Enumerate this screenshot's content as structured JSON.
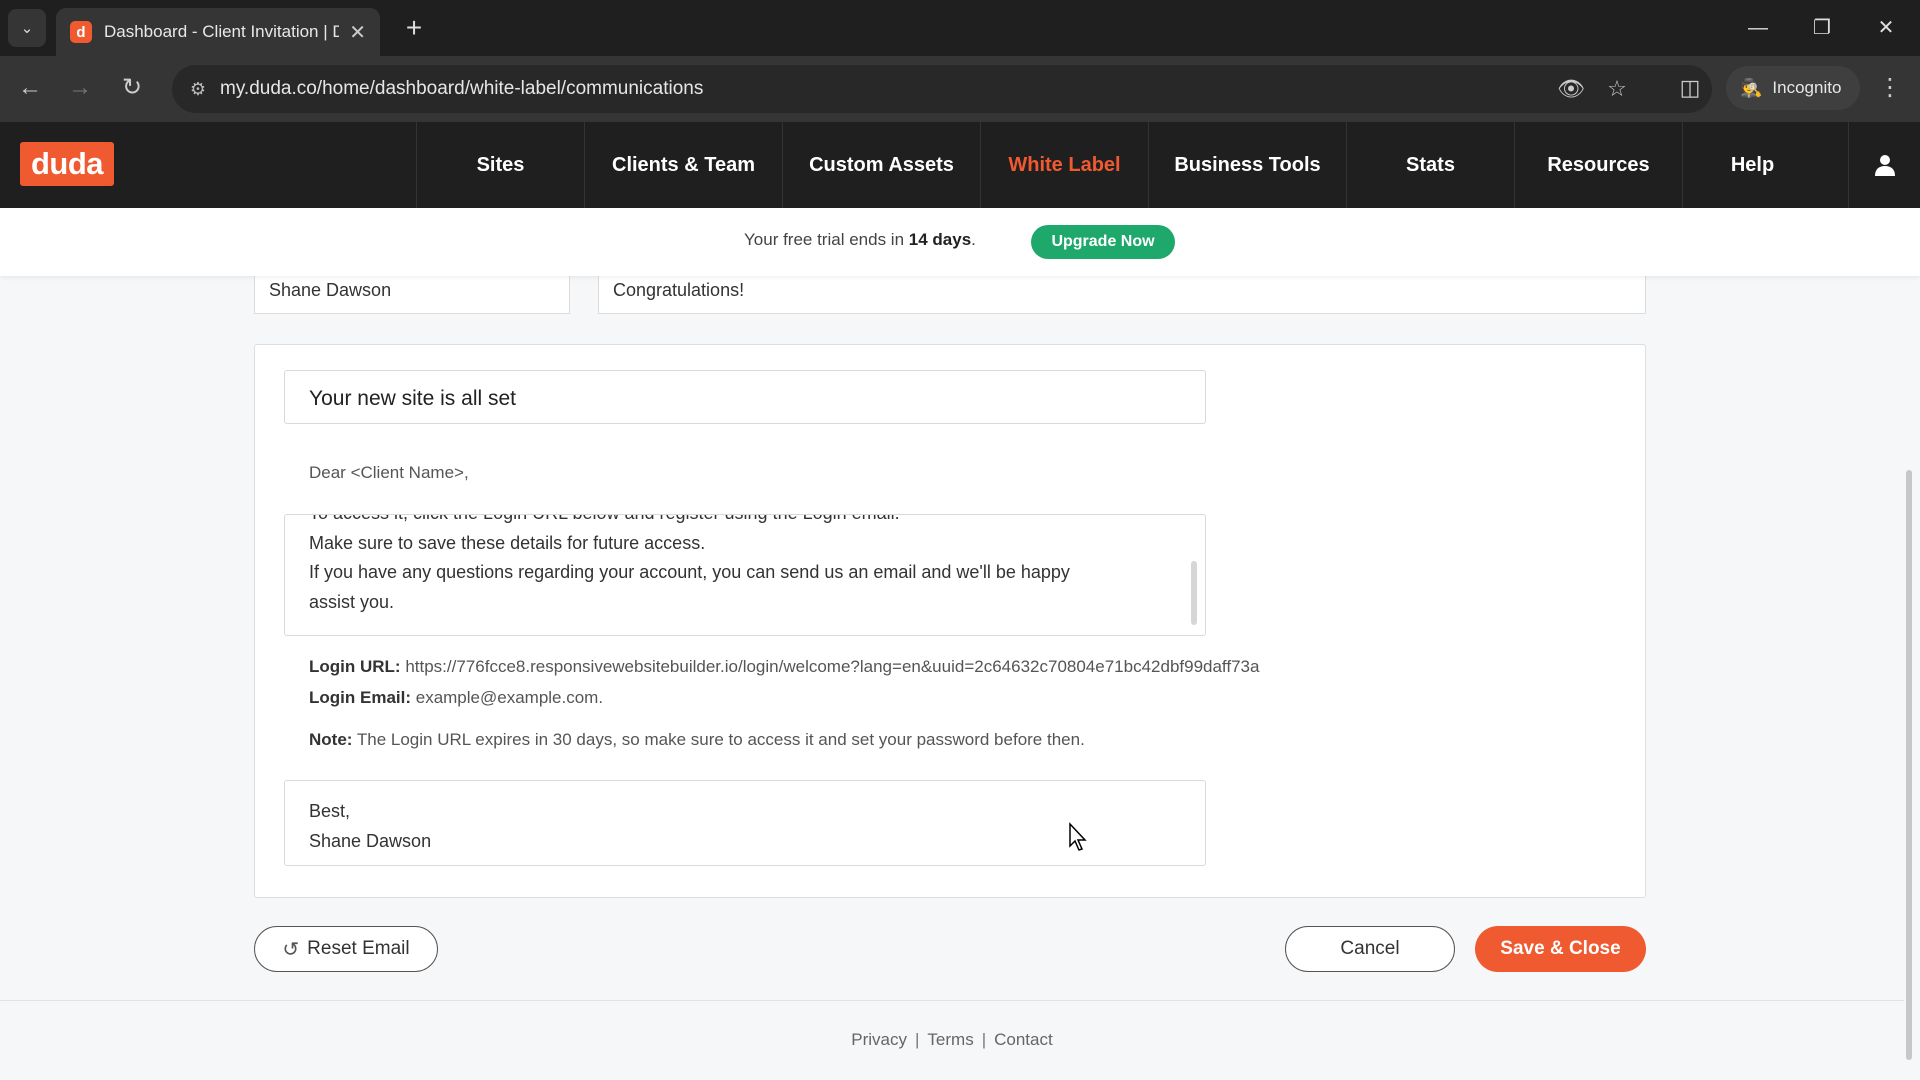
{
  "browser": {
    "tab_title": "Dashboard - Client Invitation | D",
    "url": "my.duda.co/home/dashboard/white-label/communications",
    "incognito_label": "Incognito"
  },
  "app": {
    "logo": "duda",
    "nav": [
      "Sites",
      "Clients & Team",
      "Custom Assets",
      "White Label",
      "Business Tools",
      "Stats",
      "Resources",
      "Help"
    ],
    "active_nav": "White Label",
    "accent_color": "#f05a30"
  },
  "trial": {
    "prefix": "Your free trial ends in",
    "days": "14 days",
    "suffix": ".",
    "upgrade_label": "Upgrade Now"
  },
  "email": {
    "from_name": "Shane Dawson",
    "headline": "Congratulations!",
    "subject": "Your new site is all set",
    "greeting": "Dear <Client Name>,",
    "body_lines": [
      "To access it, click the Login URL below and register using the Login email.",
      "Make sure to save these details for future access.",
      "If you have any questions regarding your account, you can send us an email and we'll be happy",
      "assist you."
    ],
    "login_url_label": "Login URL:",
    "login_url": "https://776fcce8.responsivewebsitebuilder.io/login/welcome?lang=en&uuid=2c64632c70804e71bc42dbf99daff73a",
    "login_email_label": "Login Email:",
    "login_email": "example@example.com.",
    "note_label": "Note:",
    "note": "The Login URL expires in 30 days, so make sure to access it and set your password before then.",
    "signoff_line1": "Best,",
    "signoff_line2": "Shane Dawson"
  },
  "actions": {
    "reset_label": "Reset Email",
    "cancel_label": "Cancel",
    "save_label": "Save & Close"
  },
  "footer": {
    "privacy": "Privacy",
    "terms": "Terms",
    "contact": "Contact"
  }
}
